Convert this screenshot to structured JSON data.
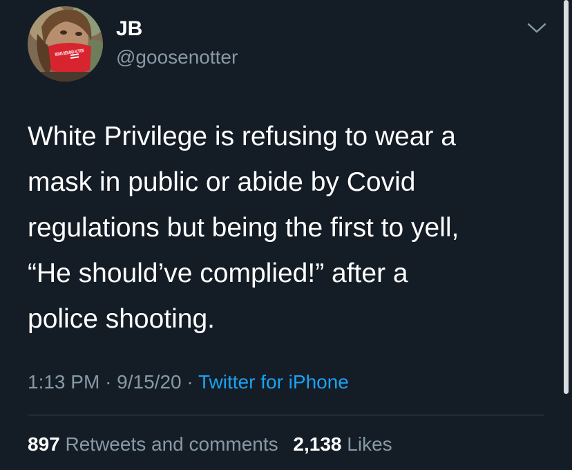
{
  "author": {
    "name": "JB",
    "handle": "@goosenotter",
    "avatar_mask_text": "MOMS DEMAND ACTION"
  },
  "tweet": {
    "text": "White Privilege is refusing to wear a\nmask in public or abide by Covid\nregulations but being the first to yell,\n“He should’ve complied!” after a\npolice shooting."
  },
  "meta": {
    "time": "1:13 PM",
    "separator": "·",
    "date": "9/15/20",
    "source": "Twitter for iPhone"
  },
  "stats": {
    "retweets_count": "897",
    "retweets_label": "Retweets and comments",
    "likes_count": "2,138",
    "likes_label": "Likes"
  },
  "colors": {
    "background": "#141d26",
    "secondary_text": "#8899a6",
    "link": "#1da1f2",
    "divider": "#38444d"
  },
  "icons": {
    "more_menu": "chevron-down-icon"
  }
}
